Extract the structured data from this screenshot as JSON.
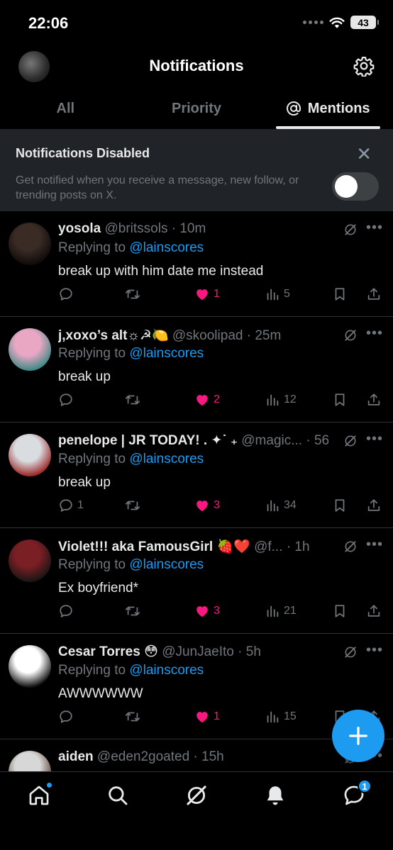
{
  "status_bar": {
    "time": "22:06",
    "battery": "43"
  },
  "header": {
    "title": "Notifications"
  },
  "tabs": [
    {
      "label": "All",
      "active": false
    },
    {
      "label": "Priority",
      "active": false
    },
    {
      "label": "Mentions",
      "active": true
    }
  ],
  "banner": {
    "title": "Notifications Disabled",
    "description": "Get notified when you receive a message, new follow, or trending posts on X.",
    "toggle_on": false
  },
  "posts": [
    {
      "name": "yosola",
      "handle": "@britssols",
      "time": "10m",
      "replying_prefix": "Replying to ",
      "replying_to": "@lainscores",
      "text": "break up with him date me instead",
      "replies": "",
      "reposts": "",
      "likes": "1",
      "views": "5",
      "avatar_colors": [
        "#3a2b25",
        "#0f0b09"
      ]
    },
    {
      "name": "j,xoxo’s alt☼☭🍋",
      "handle": "@skoolipad",
      "time": "25m",
      "replying_prefix": "Replying to ",
      "replying_to": "@lainscores",
      "text": "break up",
      "replies": "",
      "reposts": "",
      "likes": "2",
      "views": "12",
      "avatar_colors": [
        "#e9a7c4",
        "#3f8a86"
      ]
    },
    {
      "name": "penelope | JR TODAY! . ✦˙ ₊",
      "handle": "@magic...",
      "time": "56m",
      "replying_prefix": "Replying to ",
      "replying_to": "@lainscores",
      "text": "break up",
      "replies": "1",
      "reposts": "",
      "likes": "3",
      "views": "34",
      "avatar_colors": [
        "#d9dde0",
        "#9b2a2a"
      ]
    },
    {
      "name": "Violet!!! aka FamousGirl 🍓❤️",
      "handle": "@f...",
      "time": "1h",
      "replying_prefix": "Replying to ",
      "replying_to": "@lainscores",
      "text": "Ex boyfriend*",
      "replies": "",
      "reposts": "",
      "likes": "3",
      "views": "21",
      "avatar_colors": [
        "#7a1f24",
        "#1b1515"
      ]
    },
    {
      "name": "Cesar Torres 😳",
      "handle": "@JunJaeIto",
      "time": "5h",
      "replying_prefix": "Replying to ",
      "replying_to": "@lainscores",
      "text": "AWWWWWW",
      "replies": "",
      "reposts": "",
      "likes": "1",
      "views": "15",
      "avatar_colors": [
        "#ffffff",
        "#111111"
      ]
    },
    {
      "name": "aiden",
      "handle": "@eden2goated",
      "time": "15h",
      "replying_prefix": "",
      "replying_to": "",
      "text": "",
      "replies": "",
      "reposts": "",
      "likes": "",
      "views": "",
      "avatar_colors": [
        "#d7d7d7",
        "#5a4030"
      ]
    }
  ],
  "bottom_nav": {
    "items": [
      "home-icon",
      "search-icon",
      "grok-icon",
      "bell-icon",
      "messages-icon"
    ],
    "messages_badge": "1"
  },
  "colors": {
    "accent": "#1d9bf0",
    "like": "#f91880",
    "muted": "#71767b",
    "banner_bg": "#202327"
  }
}
